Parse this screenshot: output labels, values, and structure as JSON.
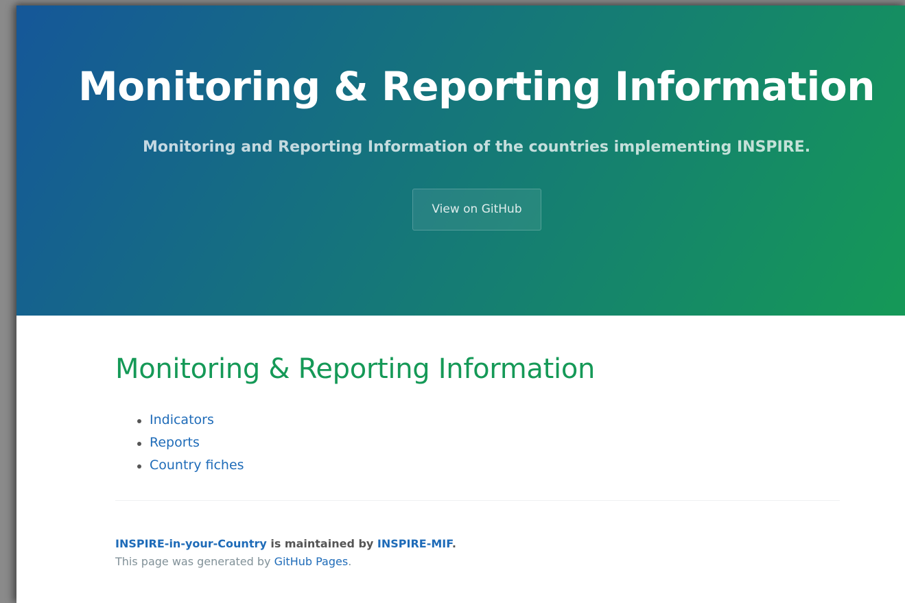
{
  "header": {
    "title": "Monitoring & Reporting Information",
    "tagline": "Monitoring and Reporting Information of the countries implementing INSPIRE.",
    "button_label": "View on GitHub",
    "gradient_start": "#155799",
    "gradient_end": "#159957"
  },
  "main": {
    "heading": "Monitoring & Reporting Information",
    "heading_color": "#159957",
    "links": [
      {
        "label": "Indicators"
      },
      {
        "label": "Reports"
      },
      {
        "label": "Country fiches"
      }
    ],
    "link_color": "#1e6bb8"
  },
  "footer": {
    "repo_link": "INSPIRE-in-your-Country",
    "maintained_text": " is maintained by ",
    "owner_link": "INSPIRE-MIF",
    "period": ".",
    "credits_prefix": "This page was generated by ",
    "credits_link": "GitHub Pages",
    "credits_suffix": "."
  }
}
